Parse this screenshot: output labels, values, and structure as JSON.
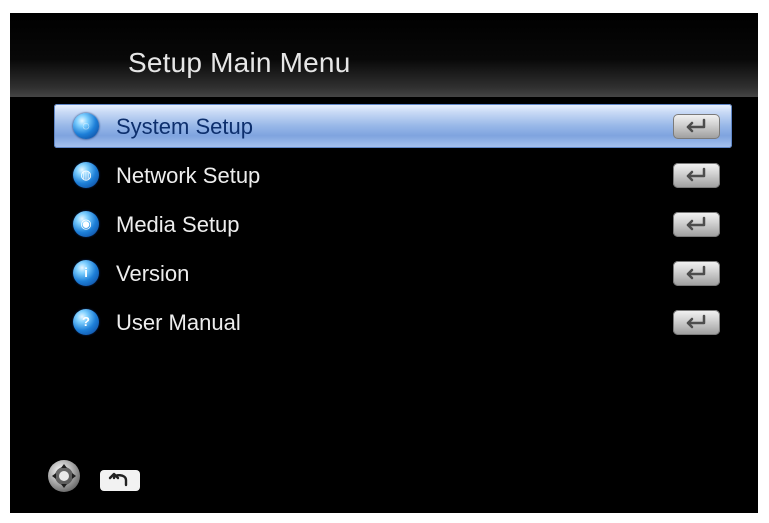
{
  "header": {
    "title": "Setup Main Menu"
  },
  "menu": {
    "selected_index": 0,
    "items": [
      {
        "label": "System Setup",
        "icon": "globe-icon",
        "enter_icon": "enter-icon"
      },
      {
        "label": "Network Setup",
        "icon": "network-globe-icon",
        "enter_icon": "enter-icon"
      },
      {
        "label": "Media Setup",
        "icon": "media-globe-icon",
        "enter_icon": "enter-icon"
      },
      {
        "label": "Version",
        "icon": "info-icon",
        "enter_icon": "enter-icon"
      },
      {
        "label": "User Manual",
        "icon": "help-icon",
        "enter_icon": "enter-icon"
      }
    ]
  },
  "footer": {
    "nav_icon": "dpad-icon",
    "return_icon": "return-icon"
  },
  "colors": {
    "background": "#000000",
    "selection": "#97b7e8",
    "text": "#ededed"
  }
}
